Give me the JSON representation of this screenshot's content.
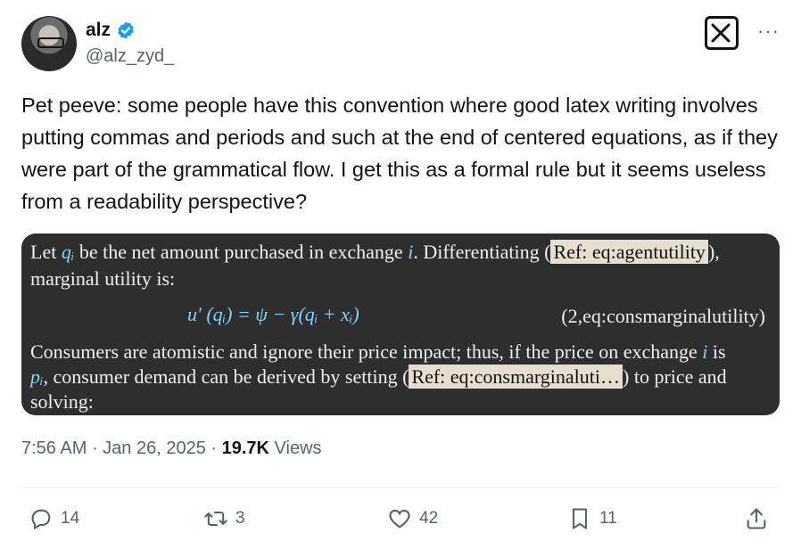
{
  "author": {
    "display_name": "alz",
    "handle": "@alz_zyd_",
    "verified": true,
    "avatar_icon": "avatar-icon"
  },
  "header_icons": {
    "logo": "x-logo-icon",
    "more": "more-icon",
    "more_glyph": "···"
  },
  "tweet": {
    "text": "Pet peeve: some people have this convention where good latex writing involves putting commas and periods and such at the end of centered equations, as if they were part of the grammatical flow. I get this as a formal rule but it seems useless from a readability perspective?"
  },
  "media": {
    "line1_a": "Let ",
    "line1_qi": "qᵢ",
    "line1_b": " be the net amount purchased in exchange ",
    "line1_i": "i",
    "line1_c": ". Differentiating (",
    "line1_ref": "Ref: eq:agentutility",
    "line1_d": "),",
    "line2": "marginal utility is:",
    "equation": "u′ (qᵢ) = ψ − γ(qᵢ + xᵢ)",
    "equation_number": "(2,eq:consmarginalutility)",
    "line4_a": "Consumers are atomistic and ignore their price impact; thus, if the price on exchange ",
    "line4_i": "i",
    "line4_b": " is",
    "line5_pi": "pᵢ",
    "line5_a": ", consumer demand can be derived by setting (",
    "line5_ref": "Ref: eq:consmarginaluti…",
    "line5_b": ") to price and",
    "line6": "solving:"
  },
  "meta": {
    "time": "7:56 AM",
    "sep1": " · ",
    "date": "Jan 26, 2025",
    "sep2": " · ",
    "views_count": "19.7K",
    "views_label": " Views"
  },
  "actions": {
    "replies": "14",
    "reposts": "3",
    "likes": "42",
    "bookmarks": "11"
  },
  "colors": {
    "accent": "#1d9bf0",
    "muted": "#536471",
    "text": "#0f1419",
    "media_bg": "#2e2e2e",
    "math": "#7fd4ff"
  }
}
